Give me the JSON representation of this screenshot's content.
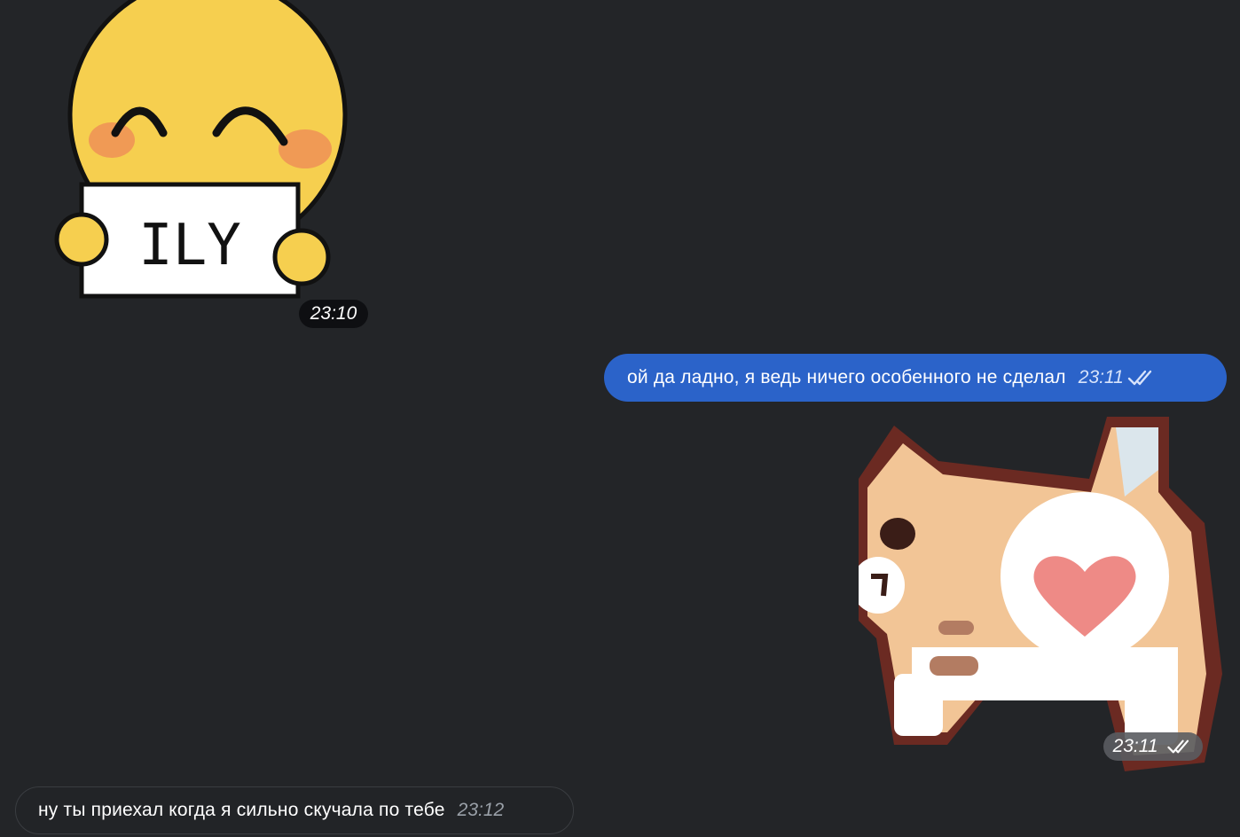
{
  "messages": [
    {
      "type": "sticker",
      "direction": "incoming",
      "sticker": "smiley-ily-sticker",
      "sign_text": "ILY",
      "time": "23:10"
    },
    {
      "type": "text",
      "direction": "outgoing",
      "text": "ой да ладно, я ведь ничего особенного не сделал",
      "time": "23:11",
      "status": "read"
    },
    {
      "type": "sticker",
      "direction": "outgoing",
      "sticker": "cat-heart-sticker",
      "time": "23:11",
      "status": "read"
    },
    {
      "type": "text",
      "direction": "incoming",
      "text": "ну ты приехал когда я сильно скучала по тебе",
      "time": "23:12"
    }
  ],
  "colors": {
    "background": "#232528",
    "outgoing_bubble": "#2b63c9",
    "incoming_bubble": "#222427"
  }
}
